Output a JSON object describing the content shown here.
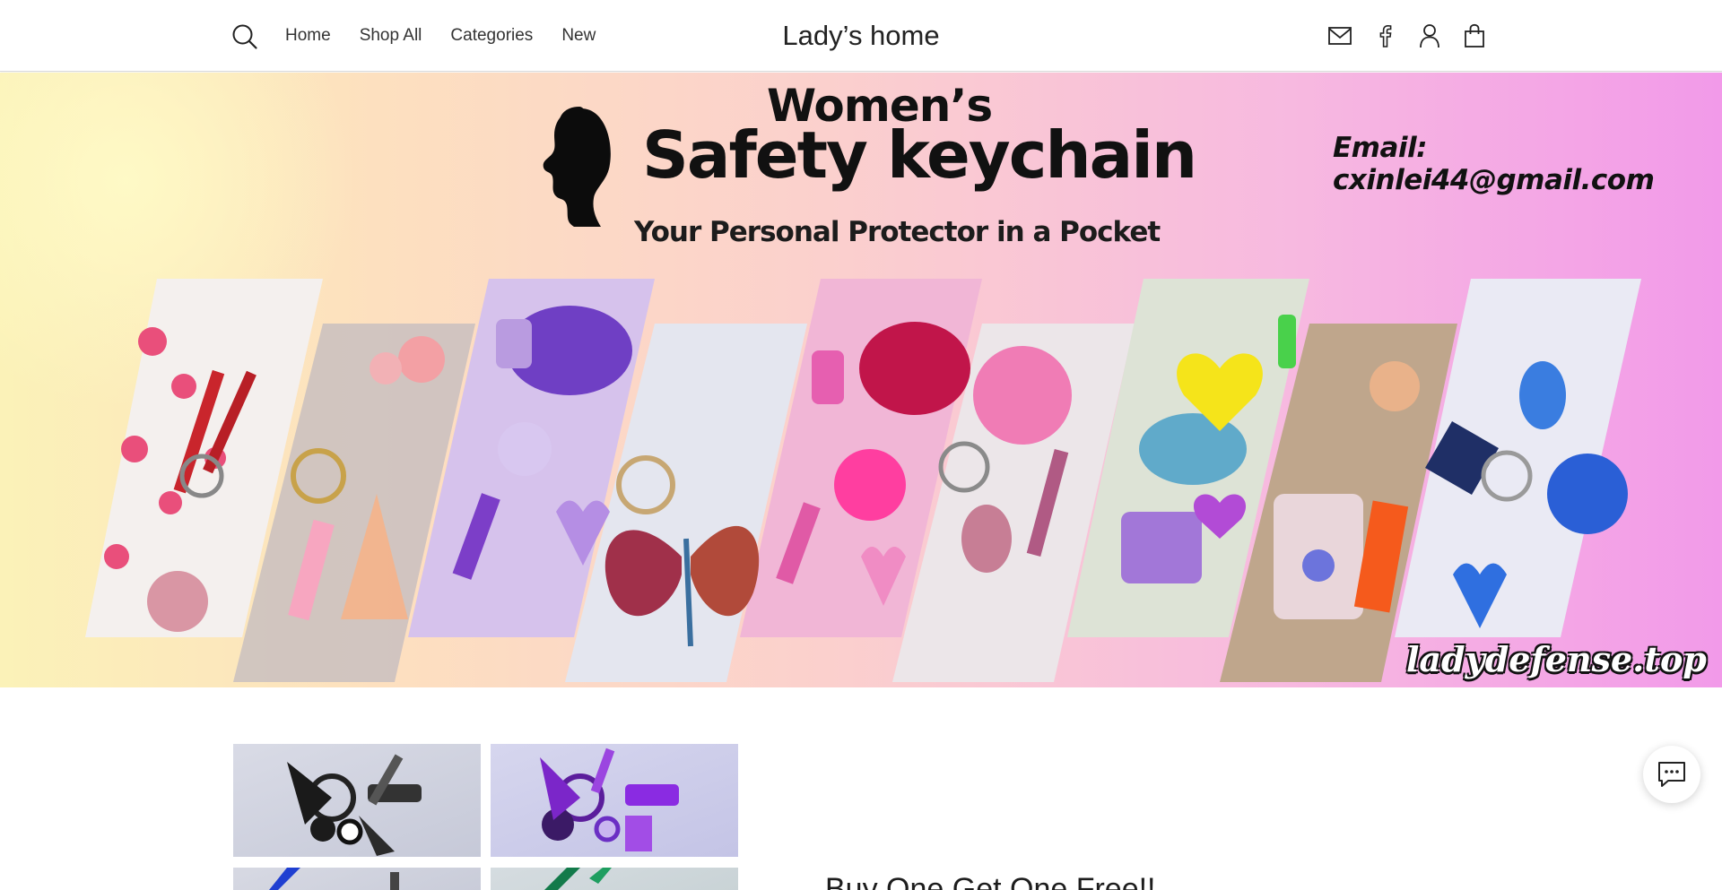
{
  "header": {
    "logo": "Lady’s home",
    "nav": [
      "Home",
      "Shop All",
      "Categories",
      "New"
    ],
    "icons": [
      "search-icon",
      "mail-icon",
      "facebook-icon",
      "account-icon",
      "cart-icon"
    ]
  },
  "hero": {
    "title_line1": "Women’s",
    "title_line2": "Safety keychain",
    "subtitle": "Your Personal Protector in a Pocket",
    "email": "Email: cxinlei44@gmail.com",
    "site": "ladydefense.top",
    "colors": {
      "left": "#fbf2b8",
      "center": "#fbd0cd",
      "right": "#f29ae9"
    }
  },
  "product": {
    "thumbnail_colors": [
      "black",
      "purple",
      "blue",
      "green"
    ],
    "promo_title": "Buy One Get One Free!!"
  },
  "chat": {
    "icon": "chat-icon"
  }
}
